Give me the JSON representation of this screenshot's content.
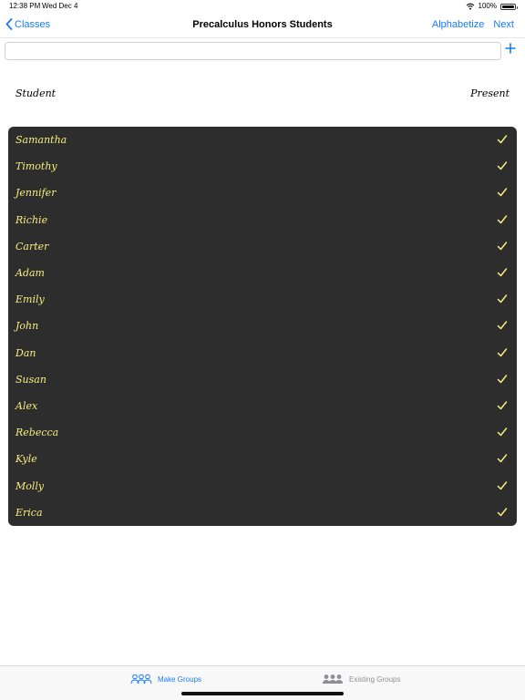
{
  "status_bar": {
    "time": "12:38 PM",
    "date": "Wed Dec 4",
    "battery": "100%",
    "wifi_icon": "wifi-icon",
    "battery_icon": "battery-icon"
  },
  "nav": {
    "back_label": "Classes",
    "title": "Precalculus Honors Students",
    "alphabetize_label": "Alphabetize",
    "next_label": "Next"
  },
  "add_student": {
    "value": "",
    "placeholder": "",
    "add_icon": "plus-icon"
  },
  "table": {
    "header_student": "Student",
    "header_present": "Present",
    "students": [
      {
        "name": "Samantha",
        "present": true
      },
      {
        "name": "Timothy",
        "present": true
      },
      {
        "name": "Jennifer",
        "present": true
      },
      {
        "name": "Richie",
        "present": true
      },
      {
        "name": "Carter",
        "present": true
      },
      {
        "name": "Adam",
        "present": true
      },
      {
        "name": "Emily",
        "present": true
      },
      {
        "name": "John",
        "present": true
      },
      {
        "name": "Dan",
        "present": true
      },
      {
        "name": "Susan",
        "present": true
      },
      {
        "name": "Alex",
        "present": true
      },
      {
        "name": "Rebecca",
        "present": true
      },
      {
        "name": "Kyle",
        "present": true
      },
      {
        "name": "Molly",
        "present": true
      },
      {
        "name": "Erica",
        "present": true
      }
    ]
  },
  "tab_bar": {
    "make_groups_label": "Make Groups",
    "existing_groups_label": "Existing Groups",
    "active_tab": "Make Groups"
  },
  "colors": {
    "accent": "#1a7bf2",
    "list_background": "#2d2d2d",
    "student_text": "#f7ee7c",
    "inactive_tab": "#8e8e93"
  }
}
